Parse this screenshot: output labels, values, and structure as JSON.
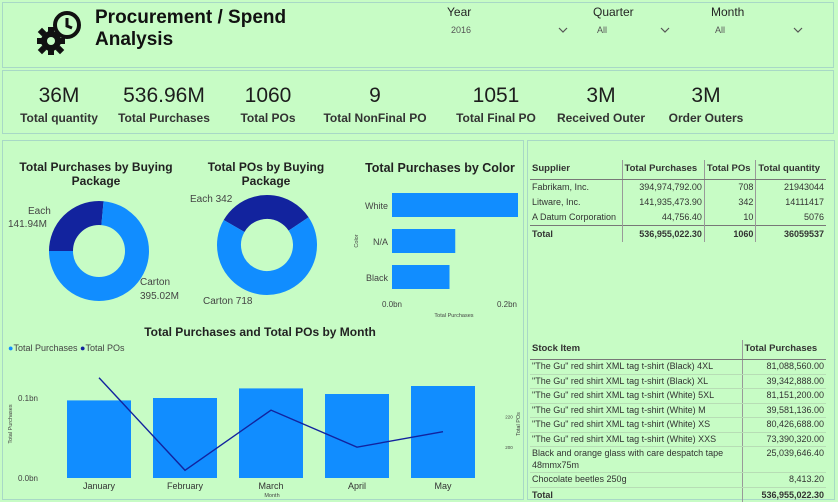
{
  "header": {
    "title": "Procurement / Spend Analysis",
    "slicers": [
      {
        "label": "Year",
        "value": "2016"
      },
      {
        "label": "Quarter",
        "value": "All"
      },
      {
        "label": "Month",
        "value": "All"
      }
    ]
  },
  "kpis": [
    {
      "value": "36M",
      "caption": "Total quantity"
    },
    {
      "value": "536.96M",
      "caption": "Total Purchases"
    },
    {
      "value": "1060",
      "caption": "Total POs"
    },
    {
      "value": "9",
      "caption": "Total NonFinal PO"
    },
    {
      "value": "1051",
      "caption": "Total Final PO"
    },
    {
      "value": "3M",
      "caption": "Received Outer"
    },
    {
      "value": "3M",
      "caption": "Order Outers"
    }
  ],
  "colors": {
    "primary": "#118dff",
    "dark": "#12239e",
    "background": "#c7fcc5"
  },
  "chart_data": [
    {
      "type": "pie",
      "title": "Total Purchases by Buying Package",
      "categories": [
        "Each",
        "Carton"
      ],
      "values": [
        141.94,
        395.02
      ],
      "labels": [
        "141.94M",
        "395.02M"
      ],
      "colors": [
        "#12239e",
        "#118dff"
      ]
    },
    {
      "type": "pie",
      "title": "Total POs by Buying Package",
      "categories": [
        "Each",
        "Carton"
      ],
      "values": [
        342,
        718
      ],
      "labels": [
        "342",
        "718"
      ],
      "colors": [
        "#12239e",
        "#118dff"
      ]
    },
    {
      "type": "bar",
      "orientation": "horizontal",
      "title": "Total Purchases by Color",
      "categories": [
        "White",
        "N/A",
        "Black"
      ],
      "values": [
        0.26,
        0.11,
        0.1
      ],
      "xlabel": "Total Purchases",
      "ylabel": "Color",
      "xticks": [
        "0.0bn",
        "0.2bn"
      ]
    },
    {
      "type": "bar",
      "title": "Total Purchases and Total POs by Month",
      "categories": [
        "January",
        "February",
        "March",
        "April",
        "May"
      ],
      "series": [
        {
          "name": "Total Purchases",
          "values": [
            0.097,
            0.1,
            0.112,
            0.105,
            0.115
          ]
        },
        {
          "name": "Total POs",
          "values": [
            245,
            185,
            224,
            200,
            210
          ]
        }
      ],
      "xlabel": "Month",
      "ylabel": "Total Purchases",
      "y2label": "Total POs",
      "yticks": [
        "0.1bn",
        "0.0bn"
      ],
      "y2ticks": [
        "220",
        "200"
      ]
    }
  ],
  "supplier_table": {
    "headers": [
      "Supplier",
      "Total Purchases",
      "Total POs",
      "Total quantity"
    ],
    "rows": [
      [
        "Fabrikam, Inc.",
        "394,974,792.00",
        "708",
        "21943044"
      ],
      [
        "Litware, Inc.",
        "141,935,473.90",
        "342",
        "14111417"
      ],
      [
        "A Datum Corporation",
        "44,756.40",
        "10",
        "5076"
      ]
    ],
    "total": [
      "Total",
      "536,955,022.30",
      "1060",
      "36059537"
    ]
  },
  "stock_table": {
    "headers": [
      "Stock Item",
      "Total Purchases"
    ],
    "rows": [
      [
        "\"The Gu\" red shirt XML tag t-shirt (Black) 4XL",
        "81,088,560.00"
      ],
      [
        "\"The Gu\" red shirt XML tag t-shirt (Black) XL",
        "39,342,888.00"
      ],
      [
        "\"The Gu\" red shirt XML tag t-shirt (White) 5XL",
        "81,151,200.00"
      ],
      [
        "\"The Gu\" red shirt XML tag t-shirt (White) M",
        "39,581,136.00"
      ],
      [
        "\"The Gu\" red shirt XML tag t-shirt (White) XS",
        "80,426,688.00"
      ],
      [
        "\"The Gu\" red shirt XML tag t-shirt (White) XXS",
        "73,390,320.00"
      ],
      [
        "Black and orange glass with care despatch tape 48mmx75m",
        "25,039,646.40"
      ],
      [
        "Chocolate beetles 250g",
        "8,413.20"
      ]
    ],
    "total": [
      "Total",
      "536,955,022.30"
    ]
  }
}
